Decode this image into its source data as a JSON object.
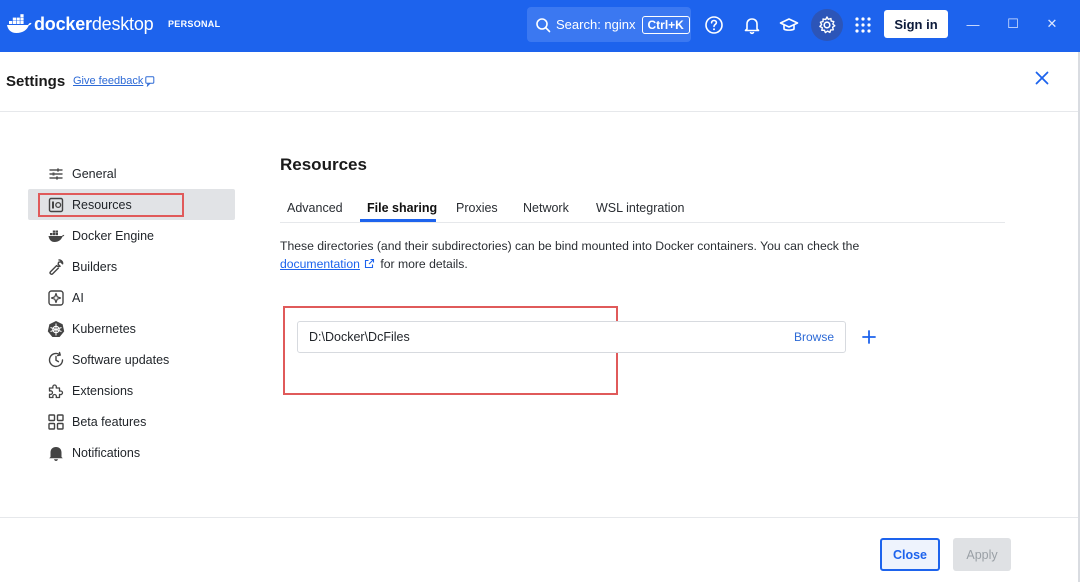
{
  "titlebar": {
    "logo_bold": "docker",
    "logo_thin": "desktop",
    "plan_badge": "PERSONAL",
    "search_label": "Search: nginx",
    "search_shortcut": "Ctrl+K",
    "signin_label": "Sign in",
    "minimize_glyph": "—",
    "maximize_glyph": "☐",
    "close_glyph": "✕",
    "bg_color": "#1d63ed"
  },
  "settings": {
    "title": "Settings",
    "feedback_label": "Give feedback"
  },
  "sidebar": {
    "items": [
      {
        "label": "General",
        "icon": "sliders-icon"
      },
      {
        "label": "Resources",
        "icon": "resources-icon",
        "active": true
      },
      {
        "label": "Docker Engine",
        "icon": "docker-whale-icon"
      },
      {
        "label": "Builders",
        "icon": "wrench-icon"
      },
      {
        "label": "AI",
        "icon": "ai-sparkle-icon"
      },
      {
        "label": "Kubernetes",
        "icon": "kubernetes-icon"
      },
      {
        "label": "Software updates",
        "icon": "update-clock-icon"
      },
      {
        "label": "Extensions",
        "icon": "puzzle-icon"
      },
      {
        "label": "Beta features",
        "icon": "grid-icon"
      },
      {
        "label": "Notifications",
        "icon": "bell-icon"
      }
    ]
  },
  "main": {
    "title": "Resources",
    "tabs": [
      {
        "label": "Advanced"
      },
      {
        "label": "File sharing",
        "active": true
      },
      {
        "label": "Proxies"
      },
      {
        "label": "Network"
      },
      {
        "label": "WSL integration"
      }
    ],
    "description_pre": "These directories (and their subdirectories) can be bind mounted into Docker containers. You can check the ",
    "description_link": "documentation",
    "description_post": " for more details.",
    "path_value": "D:\\Docker\\DcFiles",
    "browse_label": "Browse"
  },
  "footer": {
    "close_label": "Close",
    "apply_label": "Apply"
  },
  "colors": {
    "accent": "#1d63ed",
    "highlight": "#e05a5a"
  }
}
